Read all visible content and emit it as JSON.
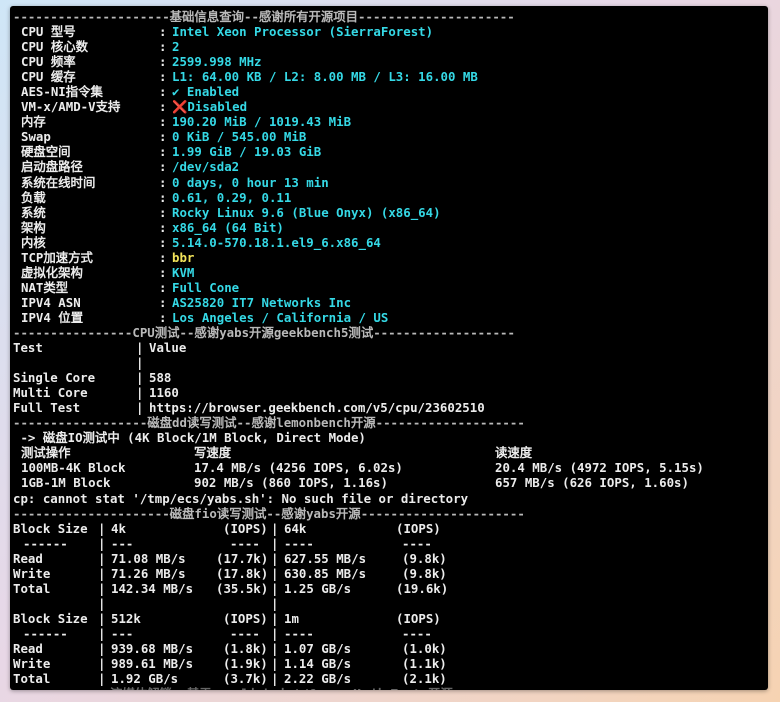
{
  "basic": {
    "header": "---------------------基础信息查询--感谢所有开源项目---------------------",
    "rows": [
      {
        "label": "CPU 型号",
        "sep": ":",
        "value": "Intel Xeon Processor (SierraForest)"
      },
      {
        "label": "CPU 核心数",
        "sep": ":",
        "value": "2"
      },
      {
        "label": "CPU 频率",
        "sep": ":",
        "value": "2599.998 MHz"
      },
      {
        "label": "CPU 缓存",
        "sep": ":",
        "value": "L1: 64.00 KB / L2: 8.00 MB / L3: 16.00 MB"
      },
      {
        "label": "AES-NI指令集",
        "sep": ":",
        "value": "✔ Enabled"
      },
      {
        "label": "VM-x/AMD-V支持",
        "sep": ":",
        "value": "❌Disabled"
      },
      {
        "label": "内存",
        "sep": ":",
        "value": "190.20 MiB / 1019.43 MiB"
      },
      {
        "label": "Swap",
        "sep": ":",
        "value": "0 KiB / 545.00 MiB"
      },
      {
        "label": "硬盘空间",
        "sep": ":",
        "value": "1.99 GiB / 19.03 GiB"
      },
      {
        "label": "启动盘路径",
        "sep": ":",
        "value": "/dev/sda2"
      },
      {
        "label": "系统在线时间",
        "sep": ":",
        "value": "0 days, 0 hour 13 min"
      },
      {
        "label": "负载",
        "sep": ":",
        "value": "0.61, 0.29, 0.11"
      },
      {
        "label": "系统",
        "sep": ":",
        "value": "Rocky Linux 9.6 (Blue Onyx) (x86_64)"
      },
      {
        "label": "架构",
        "sep": ":",
        "value": "x86_64 (64 Bit)"
      },
      {
        "label": "内核",
        "sep": ":",
        "value": "5.14.0-570.18.1.el9_6.x86_64"
      },
      {
        "label": "TCP加速方式",
        "sep": ":",
        "value": "bbr"
      },
      {
        "label": "虚拟化架构",
        "sep": ":",
        "value": "KVM"
      },
      {
        "label": "NAT类型",
        "sep": ":",
        "value": "Full Cone"
      },
      {
        "label": "IPV4 ASN",
        "sep": ":",
        "value": "AS25820 IT7 Networks Inc"
      },
      {
        "label": "IPV4 位置",
        "sep": ":",
        "value": "Los Angeles / California / US"
      }
    ],
    "colors": {
      "label": "#ececec",
      "value": "#35d9e6",
      "tcp_value": "#f2e35a"
    }
  },
  "cpu": {
    "header": "----------------CPU测试--感谢yabs开源geekbench5测试-------------------",
    "lines": [
      [
        "Test",
        "|",
        "Value"
      ],
      [
        "",
        "|",
        ""
      ],
      [
        "Single Core",
        "|",
        "588"
      ],
      [
        "Multi Core",
        "|",
        "1160"
      ],
      [
        "Full Test",
        "|",
        "https://browser.geekbench.com/v5/cpu/23602510"
      ]
    ]
  },
  "dd": {
    "header": "------------------磁盘dd读写测试--感谢lemonbench开源--------------------",
    "title": " -> 磁盘IO测试中 (4K Block/1M Block, Direct Mode)",
    "columns": [
      "测试操作",
      "写速度",
      "读速度"
    ],
    "rows": [
      [
        "100MB-4K Block",
        "17.4 MB/s (4256 IOPS, 6.02s)",
        "20.4 MB/s (4972 IOPS, 5.15s)"
      ],
      [
        "1GB-1M Block",
        "902 MB/s (860 IOPS, 1.16s)",
        "657 MB/s (626 IOPS, 1.60s)"
      ]
    ],
    "error": "cp: cannot stat '/tmp/ecs/yabs.sh': No such file or directory"
  },
  "fio": {
    "header": "---------------------磁盘fio读写测试--感谢yabs开源----------------------",
    "lines": [
      [
        "Block Size",
        "|",
        "4k",
        "(IOPS)",
        "|",
        "64k",
        "(IOPS)"
      ],
      [
        "------",
        "|",
        "---",
        "----",
        "|",
        "----",
        "----"
      ],
      [
        "Read",
        "|",
        "71.08 MB/s",
        "(17.7k)",
        "|",
        "627.55 MB/s",
        "(9.8k)"
      ],
      [
        "Write",
        "|",
        "71.26 MB/s",
        "(17.8k)",
        "|",
        "630.85 MB/s",
        "(9.8k)"
      ],
      [
        "Total",
        "|",
        "142.34 MB/s",
        "(35.5k)",
        "|",
        "1.25 GB/s",
        "(19.6k)"
      ],
      [
        "",
        "|",
        "",
        "",
        "|",
        "",
        ""
      ],
      [
        "Block Size",
        "|",
        "512k",
        "(IOPS)",
        "|",
        "1m",
        "(IOPS)"
      ],
      [
        "------",
        "|",
        "---",
        "----",
        "|",
        "----",
        "----"
      ],
      [
        "Read",
        "|",
        "939.68 MB/s",
        "(1.8k)",
        "|",
        "1.07 GB/s",
        "(1.0k)"
      ],
      [
        "Write",
        "|",
        "989.61 MB/s",
        "(1.9k)",
        "|",
        "1.14 GB/s",
        "(1.1k)"
      ],
      [
        "Total",
        "|",
        "1.92 GB/s",
        "(3.7k)",
        "|",
        "2.22 GB/s",
        "(2.1k)"
      ]
    ],
    "cutoff": "-------------流媒体解锁--基于oneclickvirt/CommonMediaTests开源------------"
  }
}
